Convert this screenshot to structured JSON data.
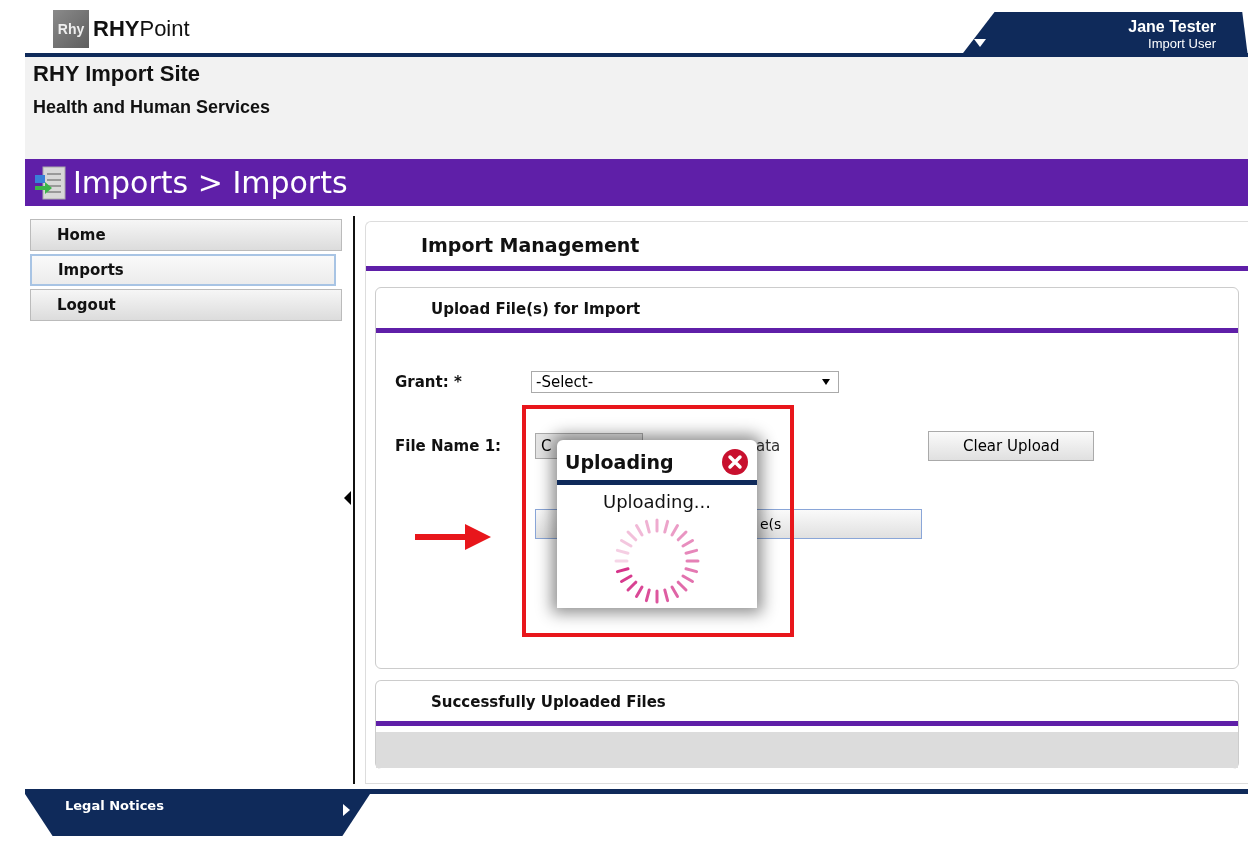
{
  "header": {
    "logo_badge": "Rhy",
    "brand_bold": "RHY",
    "brand_rest": "Point",
    "user_name": "Jane Tester",
    "user_role": "Import User"
  },
  "site": {
    "title": "RHY Import Site",
    "subtitle": "Health and Human Services"
  },
  "page_title": "Imports > Imports",
  "sidebar": {
    "items": [
      {
        "label": "Home",
        "selected": false
      },
      {
        "label": "Imports",
        "selected": true
      },
      {
        "label": "Logout",
        "selected": false
      }
    ]
  },
  "main": {
    "title": "Import Management",
    "upload_panel": {
      "heading": "Upload File(s) for Import",
      "grant_label": "Grant: *",
      "grant_value": "-Select-",
      "file_label": "File Name 1:",
      "file_button": "C",
      "file_status": "ata",
      "clear_button": "Clear Upload",
      "upload_button": "e(s"
    },
    "uploaded_panel": {
      "heading": "Successfully Uploaded Files"
    }
  },
  "dialog": {
    "title": "Uploading",
    "message": "Uploading..."
  },
  "footer": {
    "link": "Legal Notices"
  }
}
